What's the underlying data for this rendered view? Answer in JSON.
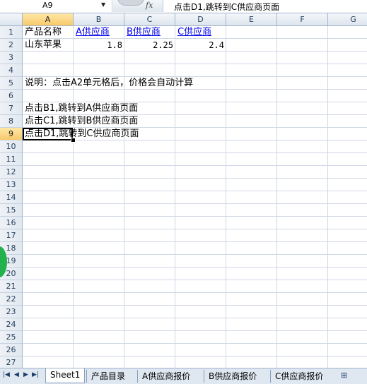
{
  "formula_bar": {
    "name_box": "A9",
    "fx_label": "fx",
    "formula": "点击D1,跳转到C供应商页面"
  },
  "columns": [
    "A",
    "B",
    "C",
    "D",
    "E",
    "F",
    "G"
  ],
  "rows": [
    "1",
    "2",
    "3",
    "4",
    "5",
    "6",
    "7",
    "8",
    "9",
    "10",
    "11",
    "12",
    "13",
    "14",
    "15",
    "16",
    "17",
    "18",
    "19",
    "20",
    "21",
    "22",
    "23",
    "24",
    "25",
    "26",
    "27"
  ],
  "selected": {
    "column": "A",
    "row": "9"
  },
  "cells": {
    "A1": "产品名称",
    "B1": "A供应商",
    "C1": "B供应商",
    "D1": "C供应商",
    "A2": "山东苹果",
    "B2": "1.8",
    "C2": "2.25",
    "D2": "2.4",
    "A5": "说明：点击A2单元格后，价格会自动计算",
    "A7": "点击B1,跳转到A供应商页面",
    "A8": "点击C1,跳转到B供应商页面",
    "A9": "点击D1,跳转到C供应商页面"
  },
  "sheet_tabs": [
    "Sheet1",
    "产品目录",
    "A供应商报价",
    "B供应商报价",
    "C供应商报价"
  ],
  "active_tab": "Sheet1",
  "colors": {
    "header_bg": "#dde4ec",
    "selected_header": "#f7c86a",
    "link": "#0000ee",
    "gridline": "#d0d7e5"
  }
}
